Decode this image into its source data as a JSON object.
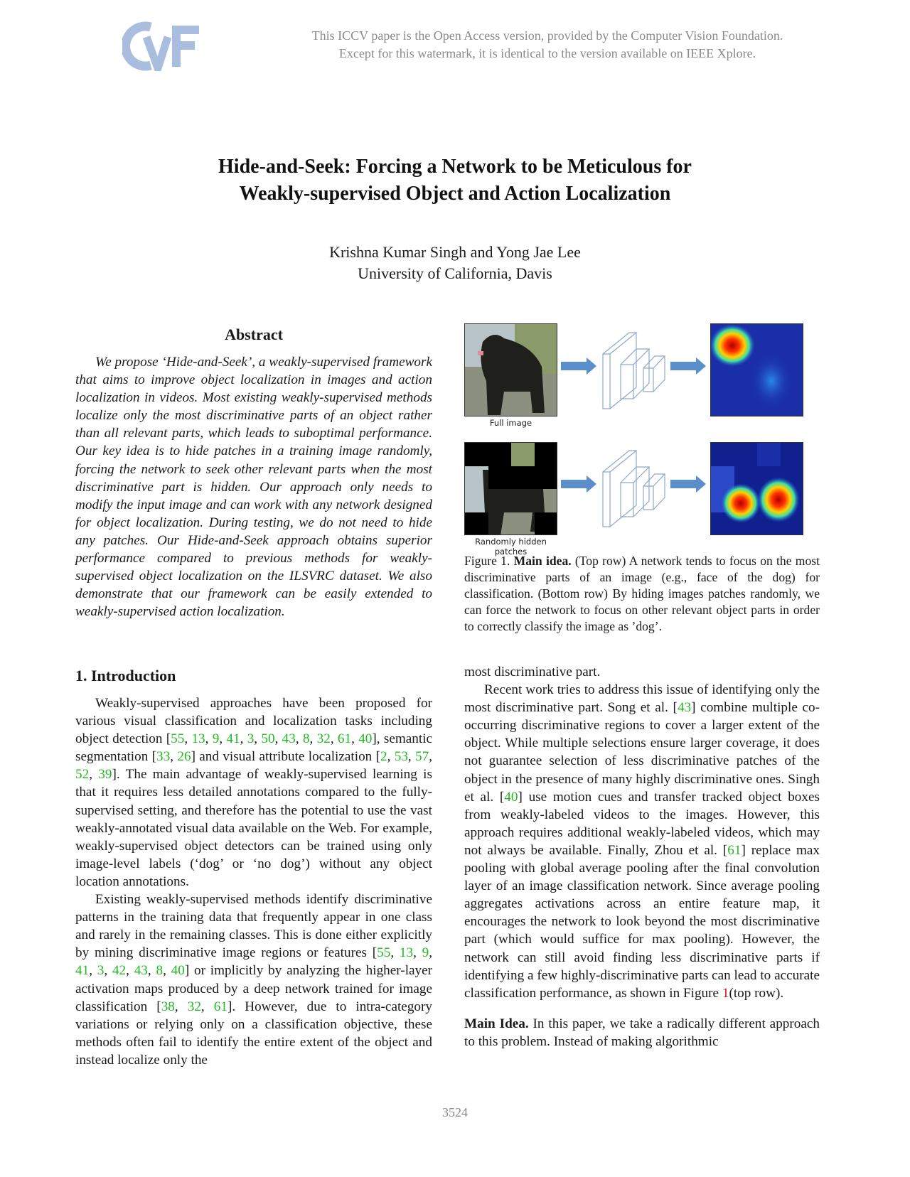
{
  "watermark": {
    "logo_text": "CVF",
    "line1": "This ICCV paper is the Open Access version, provided by the Computer Vision Foundation.",
    "line2": "Except for this watermark, it is identical to the version available on IEEE Xplore."
  },
  "title": {
    "line1": "Hide-and-Seek: Forcing a Network to be Meticulous for",
    "line2": "Weakly-supervised Object and Action Localization"
  },
  "authors": {
    "names": "Krishna Kumar Singh and Yong Jae Lee",
    "affiliation": "University of California, Davis"
  },
  "abstract": {
    "heading": "Abstract",
    "text": "We propose ‘Hide-and-Seek’, a weakly-supervised framework that aims to improve object localization in images and action localization in videos.  Most existing weakly-supervised methods localize only the most discriminative parts of an object rather than all relevant parts, which leads to suboptimal performance.  Our key idea is to hide patches in a training image randomly, forcing the network to seek other relevant parts when the most discriminative part is hidden.  Our approach only needs to modify the input image and can work with any network designed for object localization.  During testing, we do not need to hide any patches. Our Hide-and-Seek approach obtains superior performance compared to previous methods for weakly-supervised object localization on the ILSVRC dataset.  We also demonstrate that our framework can be easily extended to weakly-supervised action localization."
  },
  "introduction": {
    "heading": "1. Introduction",
    "p1": [
      {
        "t": "Weakly-supervised approaches have been proposed for various visual classification and localization tasks including object detection ["
      },
      {
        "c": "55"
      },
      {
        "t": ", "
      },
      {
        "c": "13"
      },
      {
        "t": ", "
      },
      {
        "c": "9"
      },
      {
        "t": ", "
      },
      {
        "c": "41"
      },
      {
        "t": ", "
      },
      {
        "c": "3"
      },
      {
        "t": ", "
      },
      {
        "c": "50"
      },
      {
        "t": ", "
      },
      {
        "c": "43"
      },
      {
        "t": ", "
      },
      {
        "c": "8"
      },
      {
        "t": ", "
      },
      {
        "c": "32"
      },
      {
        "t": ", "
      },
      {
        "c": "61"
      },
      {
        "t": ", "
      },
      {
        "c": "40"
      },
      {
        "t": "], semantic segmentation ["
      },
      {
        "c": "33"
      },
      {
        "t": ", "
      },
      {
        "c": "26"
      },
      {
        "t": "] and visual attribute localization ["
      },
      {
        "c": "2"
      },
      {
        "t": ", "
      },
      {
        "c": "53"
      },
      {
        "t": ", "
      },
      {
        "c": "57"
      },
      {
        "t": ", "
      },
      {
        "c": "52"
      },
      {
        "t": ", "
      },
      {
        "c": "39"
      },
      {
        "t": "]. The main advantage of weakly-supervised learning is that it requires less detailed annotations compared to the fully-supervised setting, and therefore has the potential to use the vast weakly-annotated visual data available on the Web. For example, weakly-supervised object detectors can be trained using only image-level labels (‘dog’ or ‘no dog’) without any object location annotations."
      }
    ],
    "p2": [
      {
        "t": "Existing weakly-supervised methods identify discriminative patterns in the training data that frequently appear in one class and rarely in the remaining classes. This is done either explicitly by mining discriminative image regions or features ["
      },
      {
        "c": "55"
      },
      {
        "t": ", "
      },
      {
        "c": "13"
      },
      {
        "t": ", "
      },
      {
        "c": "9"
      },
      {
        "t": ", "
      },
      {
        "c": "41"
      },
      {
        "t": ", "
      },
      {
        "c": "3"
      },
      {
        "t": ", "
      },
      {
        "c": "42"
      },
      {
        "t": ", "
      },
      {
        "c": "43"
      },
      {
        "t": ", "
      },
      {
        "c": "8"
      },
      {
        "t": ", "
      },
      {
        "c": "40"
      },
      {
        "t": "] or implicitly by analyzing the higher-layer activation maps produced by a deep network trained for image classification ["
      },
      {
        "c": "38"
      },
      {
        "t": ", "
      },
      {
        "c": "32"
      },
      {
        "t": ", "
      },
      {
        "c": "61"
      },
      {
        "t": "]. However, due to intra-category variations or relying only on a classification objective, these methods often fail to identify the entire extent of the object and instead localize only the"
      }
    ]
  },
  "figure1": {
    "label_top": "Full image",
    "label_bottom": "Randomly hidden patches",
    "caption_prefix": "Figure 1. ",
    "caption_bold": "Main idea.",
    "caption_text": " (Top row) A network tends to focus on the most discriminative parts of an image (e.g., face of the dog) for classification. (Bottom row) By hiding images patches randomly, we can force the network to focus on other relevant object parts in order to correctly classify the image as ’dog’.",
    "colors": {
      "arrow": "#5b8fcc",
      "cnn_stroke": "#8fa8c8",
      "heat_bg": "#1a2ea8",
      "heat_hot": "#c81010"
    }
  },
  "right_column": {
    "continuation": "most discriminative part.",
    "p1": [
      {
        "t": "Recent work tries to address this issue of identifying only the most discriminative part. Song et al. ["
      },
      {
        "c": "43"
      },
      {
        "t": "] combine multiple co-occurring discriminative regions to cover a larger extent of the object. While multiple selections ensure larger coverage, it does not guarantee selection of less discriminative patches of the object in the presence of many highly discriminative ones. Singh et al. ["
      },
      {
        "c": "40"
      },
      {
        "t": "] use motion cues and transfer tracked object boxes from weakly-labeled videos to the images. However, this approach requires additional weakly-labeled videos, which may not always be available. Finally, Zhou et al. ["
      },
      {
        "c": "61"
      },
      {
        "t": "] replace max pooling with global average pooling after the final convolution layer of an image classification network.  Since average pooling aggregates activations across an entire feature map, it encourages the network to look beyond the most discriminative part (which would suffice for max pooling). However, the network can still avoid finding less discriminative parts if identifying a few highly-discriminative parts can lead to accurate classification performance, as shown in Figure "
      },
      {
        "f": "1"
      },
      {
        "t": "(top row)."
      }
    ],
    "main_idea_bold": "Main Idea.",
    "main_idea_text": "  In this paper, we take a radically different approach to this problem.  Instead of making algorithmic"
  },
  "page_number": "3524"
}
